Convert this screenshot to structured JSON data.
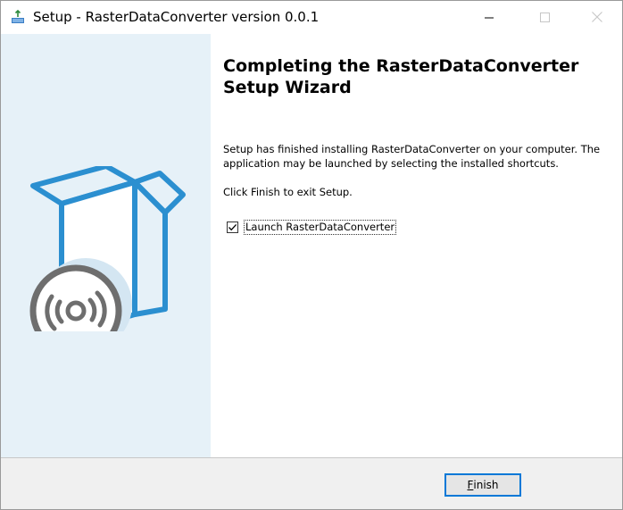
{
  "window": {
    "title": "Setup - RasterDataConverter version 0.0.1",
    "controls": [
      "minimize-icon",
      "maximize-icon",
      "close-icon"
    ]
  },
  "content": {
    "heading": "Completing the RasterDataConverter\nSetup Wizard",
    "body": "Setup has finished installing RasterDataConverter on your computer. The\napplication may be launched by selecting the installed shortcuts.",
    "exit_text": "Click Finish to exit Setup.",
    "launch_checkbox": {
      "label": "Launch RasterDataConverter",
      "checked": true
    }
  },
  "footer": {
    "finish_first": "F",
    "finish_rest": "inish"
  },
  "colors": {
    "banner_bg": "#e6f1f8",
    "accent": "#0078d7",
    "box_blue": "#2b8fd0",
    "disc_gray": "#6e6e6e"
  }
}
